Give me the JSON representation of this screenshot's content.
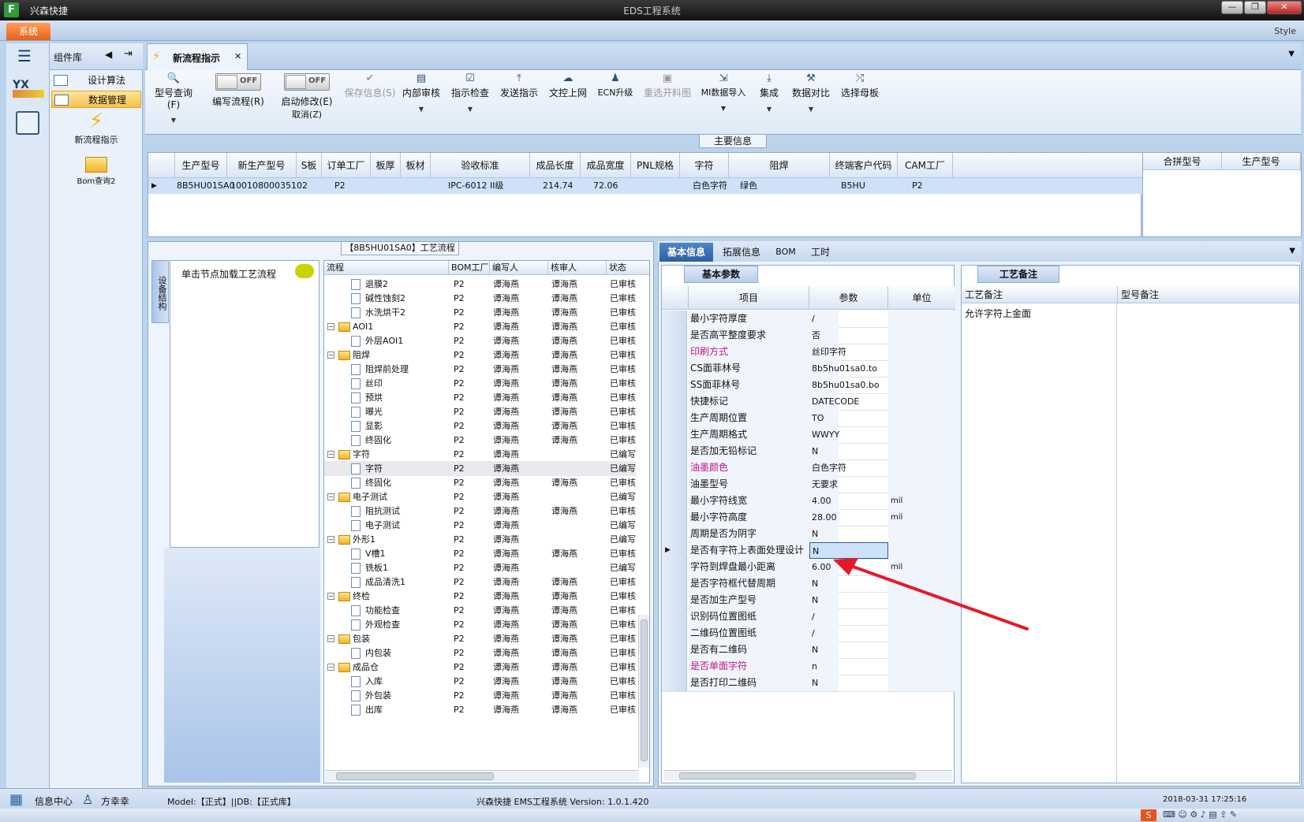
{
  "window": {
    "app_name": "兴森快捷",
    "title": "EDS工程系统",
    "style_label": "Style"
  },
  "menu": {
    "system": "系统"
  },
  "leftnav": {
    "header": "组件库",
    "items": [
      {
        "label": "设计算法"
      },
      {
        "label": "数据管理"
      }
    ],
    "launchers": [
      {
        "label": "新流程指示"
      },
      {
        "label": "Bom查询2"
      }
    ]
  },
  "tab": {
    "label": "新流程指示"
  },
  "ribbon": {
    "query": "型号查询(F)",
    "toggle1": {
      "state": "OFF",
      "label": "编写流程(R)"
    },
    "toggle2": {
      "state": "OFF",
      "label": "启动修改(E)",
      "sublabel": "取消(Z)"
    },
    "buttons": [
      "保存信息(S)",
      "内部审核",
      "指示检查",
      "发送指示",
      "文控上网",
      "ECN升级",
      "重选开料图",
      "MI数据导入",
      "集成",
      "数据对比",
      "选择母板"
    ]
  },
  "main_info": {
    "label": "主要信息",
    "columns": [
      "生产型号",
      "新生产型号",
      "S板",
      "订单工厂",
      "板厚",
      "板材",
      "验收标准",
      "成品长度",
      "成品宽度",
      "PNL规格",
      "字符",
      "阻焊",
      "终端客户代码",
      "CAM工厂"
    ],
    "row": [
      "8B5HU01SA0",
      "10010800035102",
      "",
      "P2",
      "",
      "",
      "IPC-6012 II级",
      "214.74",
      "72.06",
      "",
      "白色字符",
      "绿色",
      "B5HU",
      "P2"
    ],
    "merge_columns": [
      "合拼型号",
      "生产型号"
    ]
  },
  "process": {
    "label": "【8B5HU01SA0】工艺流程",
    "side_tab": "设备结构",
    "hint": "单击节点加载工艺流程",
    "columns": [
      "流程",
      "BOM工厂",
      "编写人",
      "核审人",
      "状态"
    ],
    "rows": [
      {
        "level": 2,
        "type": "doc",
        "name": "退膜2",
        "factory": "P2",
        "writer": "谭海燕",
        "reviewer": "谭海燕",
        "status": "已审核"
      },
      {
        "level": 2,
        "type": "doc",
        "name": "碱性蚀刻2",
        "factory": "P2",
        "writer": "谭海燕",
        "reviewer": "谭海燕",
        "status": "已审核"
      },
      {
        "level": 2,
        "type": "doc",
        "name": "水洗烘干2",
        "factory": "P2",
        "writer": "谭海燕",
        "reviewer": "谭海燕",
        "status": "已审核"
      },
      {
        "level": 1,
        "type": "folder",
        "name": "AOI1",
        "factory": "P2",
        "writer": "谭海燕",
        "reviewer": "谭海燕",
        "status": "已审核"
      },
      {
        "level": 2,
        "type": "doc",
        "name": "外层AOI1",
        "factory": "P2",
        "writer": "谭海燕",
        "reviewer": "谭海燕",
        "status": "已审核"
      },
      {
        "level": 1,
        "type": "folder",
        "name": "阻焊",
        "factory": "P2",
        "writer": "谭海燕",
        "reviewer": "谭海燕",
        "status": "已审核"
      },
      {
        "level": 2,
        "type": "doc",
        "name": "阻焊前处理",
        "factory": "P2",
        "writer": "谭海燕",
        "reviewer": "谭海燕",
        "status": "已审核"
      },
      {
        "level": 2,
        "type": "doc",
        "name": "丝印",
        "factory": "P2",
        "writer": "谭海燕",
        "reviewer": "谭海燕",
        "status": "已审核"
      },
      {
        "level": 2,
        "type": "doc",
        "name": "预烘",
        "factory": "P2",
        "writer": "谭海燕",
        "reviewer": "谭海燕",
        "status": "已审核"
      },
      {
        "level": 2,
        "type": "doc",
        "name": "曝光",
        "factory": "P2",
        "writer": "谭海燕",
        "reviewer": "谭海燕",
        "status": "已审核"
      },
      {
        "level": 2,
        "type": "doc",
        "name": "显影",
        "factory": "P2",
        "writer": "谭海燕",
        "reviewer": "谭海燕",
        "status": "已审核"
      },
      {
        "level": 2,
        "type": "doc",
        "name": "终固化",
        "factory": "P2",
        "writer": "谭海燕",
        "reviewer": "谭海燕",
        "status": "已审核"
      },
      {
        "level": 1,
        "type": "folder",
        "name": "字符",
        "factory": "P2",
        "writer": "谭海燕",
        "reviewer": "",
        "status": "已编写"
      },
      {
        "level": 2,
        "type": "doc",
        "name": "字符",
        "factory": "P2",
        "writer": "谭海燕",
        "reviewer": "",
        "status": "已编写",
        "selected": true
      },
      {
        "level": 2,
        "type": "doc",
        "name": "终固化",
        "factory": "P2",
        "writer": "谭海燕",
        "reviewer": "谭海燕",
        "status": "已审核"
      },
      {
        "level": 1,
        "type": "folder",
        "name": "电子测试",
        "factory": "P2",
        "writer": "谭海燕",
        "reviewer": "",
        "status": "已编写"
      },
      {
        "level": 2,
        "type": "doc",
        "name": "阻抗测试",
        "factory": "P2",
        "writer": "谭海燕",
        "reviewer": "谭海燕",
        "status": "已审核"
      },
      {
        "level": 2,
        "type": "doc",
        "name": "电子测试",
        "factory": "P2",
        "writer": "谭海燕",
        "reviewer": "",
        "status": "已编写"
      },
      {
        "level": 1,
        "type": "folder",
        "name": "外形1",
        "factory": "P2",
        "writer": "谭海燕",
        "reviewer": "",
        "status": "已编写"
      },
      {
        "level": 2,
        "type": "doc",
        "name": "V槽1",
        "factory": "P2",
        "writer": "谭海燕",
        "reviewer": "谭海燕",
        "status": "已审核"
      },
      {
        "level": 2,
        "type": "doc",
        "name": "铣板1",
        "factory": "P2",
        "writer": "谭海燕",
        "reviewer": "",
        "status": "已编写"
      },
      {
        "level": 2,
        "type": "doc",
        "name": "成品清洗1",
        "factory": "P2",
        "writer": "谭海燕",
        "reviewer": "谭海燕",
        "status": "已审核"
      },
      {
        "level": 1,
        "type": "folder",
        "name": "终检",
        "factory": "P2",
        "writer": "谭海燕",
        "reviewer": "谭海燕",
        "status": "已审核"
      },
      {
        "level": 2,
        "type": "doc",
        "name": "功能检查",
        "factory": "P2",
        "writer": "谭海燕",
        "reviewer": "谭海燕",
        "status": "已审核"
      },
      {
        "level": 2,
        "type": "doc",
        "name": "外观检查",
        "factory": "P2",
        "writer": "谭海燕",
        "reviewer": "谭海燕",
        "status": "已审核"
      },
      {
        "level": 1,
        "type": "folder",
        "name": "包装",
        "factory": "P2",
        "writer": "谭海燕",
        "reviewer": "谭海燕",
        "status": "已审核"
      },
      {
        "level": 2,
        "type": "doc",
        "name": "内包装",
        "factory": "P2",
        "writer": "谭海燕",
        "reviewer": "谭海燕",
        "status": "已审核"
      },
      {
        "level": 1,
        "type": "folder",
        "name": "成品仓",
        "factory": "P2",
        "writer": "谭海燕",
        "reviewer": "谭海燕",
        "status": "已审核"
      },
      {
        "level": 2,
        "type": "doc",
        "name": "入库",
        "factory": "P2",
        "writer": "谭海燕",
        "reviewer": "谭海燕",
        "status": "已审核"
      },
      {
        "level": 2,
        "type": "doc",
        "name": "外包装",
        "factory": "P2",
        "writer": "谭海燕",
        "reviewer": "谭海燕",
        "status": "已审核"
      },
      {
        "level": 2,
        "type": "doc",
        "name": "出库",
        "factory": "P2",
        "writer": "谭海燕",
        "reviewer": "谭海燕",
        "status": "已审核"
      }
    ]
  },
  "right": {
    "tabs": [
      "基本信息",
      "拓展信息",
      "BOM",
      "工时"
    ],
    "basic_params_label": "基本参数",
    "param_columns": [
      "项目",
      "参数",
      "单位"
    ],
    "params": [
      {
        "item": "最小字符厚度",
        "value": "/",
        "unit": "",
        "pink": false
      },
      {
        "item": "是否高平整度要求",
        "value": "否",
        "unit": "",
        "pink": false
      },
      {
        "item": "印刷方式",
        "value": "丝印字符",
        "unit": "",
        "pink": true
      },
      {
        "item": "CS面菲林号",
        "value": "8b5hu01sa0.to",
        "unit": "",
        "pink": false
      },
      {
        "item": "SS面菲林号",
        "value": "8b5hu01sa0.bo",
        "unit": "",
        "pink": false
      },
      {
        "item": "快捷标记",
        "value": "DATECODE",
        "unit": "",
        "pink": false
      },
      {
        "item": "生产周期位置",
        "value": "TO",
        "unit": "",
        "pink": false
      },
      {
        "item": "生产周期格式",
        "value": "WWYY",
        "unit": "",
        "pink": false
      },
      {
        "item": "是否加无铅标记",
        "value": "N",
        "unit": "",
        "pink": false
      },
      {
        "item": "油墨颜色",
        "value": "白色字符",
        "unit": "",
        "pink": true
      },
      {
        "item": "油墨型号",
        "value": "无要求",
        "unit": "",
        "pink": false
      },
      {
        "item": "最小字符线宽",
        "value": "4.00",
        "unit": "mil",
        "pink": false
      },
      {
        "item": "最小字符高度",
        "value": "28.00",
        "unit": "mil",
        "pink": false
      },
      {
        "item": "周期是否为阴字",
        "value": "N",
        "unit": "",
        "pink": false
      },
      {
        "item": "是否有字符上表面处理设计",
        "value": "N",
        "unit": "",
        "pink": false,
        "current": true
      },
      {
        "item": "字符到焊盘最小距离",
        "value": "6.00",
        "unit": "mil",
        "pink": false
      },
      {
        "item": "是否字符框代替周期",
        "value": "N",
        "unit": "",
        "pink": false
      },
      {
        "item": "是否加生产型号",
        "value": "N",
        "unit": "",
        "pink": false
      },
      {
        "item": "识别码位置图纸",
        "value": "/",
        "unit": "",
        "pink": false
      },
      {
        "item": "二维码位置图纸",
        "value": "/",
        "unit": "",
        "pink": false
      },
      {
        "item": "是否有二维码",
        "value": "N",
        "unit": "",
        "pink": false
      },
      {
        "item": "是否单面字符",
        "value": "n",
        "unit": "",
        "pink": true
      },
      {
        "item": "是否打印二维码",
        "value": "N",
        "unit": "",
        "pink": false
      }
    ],
    "remarks_label": "工艺备注",
    "remark_columns": [
      "工艺备注",
      "型号备注"
    ],
    "process_remark": "允许字符上金面"
  },
  "status": {
    "info_center": "信息中心",
    "user": "方幸幸",
    "model_db": "Model:【正式】||DB:【正式库】",
    "version": "兴森快捷 EMS工程系统 Version: 1.0.1.420",
    "datetime": "2018-03-31 17:25:16"
  },
  "colors": {
    "accent": "#e6631b",
    "selection": "#cde2f8",
    "pink_text": "#c0148c",
    "arrow": "#e8182b"
  }
}
